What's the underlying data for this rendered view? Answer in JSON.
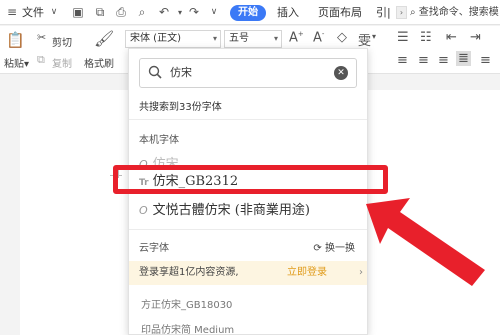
{
  "menubar": {
    "file_label": "文件",
    "start_tab": "开始",
    "insert_tab": "插入",
    "layout_tab": "页面布局",
    "reference_tab": "引|",
    "search_text": "查找命令、搜索模"
  },
  "ribbon": {
    "cut": "剪切",
    "copy": "复制",
    "paste": "粘贴",
    "format_painter": "格式刷",
    "font_name": "宋体 (正文)",
    "font_size": "五号"
  },
  "font_panel": {
    "search_value": "仿宋",
    "result_count": "共搜索到33份字体",
    "local_section": "本机字体",
    "local_fonts": [
      {
        "name": "仿宋",
        "state": "greyed"
      },
      {
        "name": "仿宋_GB2312",
        "state": "highlighted"
      },
      {
        "name": "文悦古體仿宋 (非商業用途)",
        "state": "normal"
      }
    ],
    "cloud_section": "云字体",
    "swap_label": "换一换",
    "promo_text": "登录享超1亿内容资源,",
    "promo_link": "立即登录",
    "cloud_fonts": [
      "方正仿宋_GB18030",
      "印品仿宋简 Medium"
    ]
  },
  "colors": {
    "accent_blue": "#3b79f6",
    "highlight_red": "#e8202b",
    "promo_bg": "#fdf5e1",
    "promo_link": "#e09b1a"
  }
}
